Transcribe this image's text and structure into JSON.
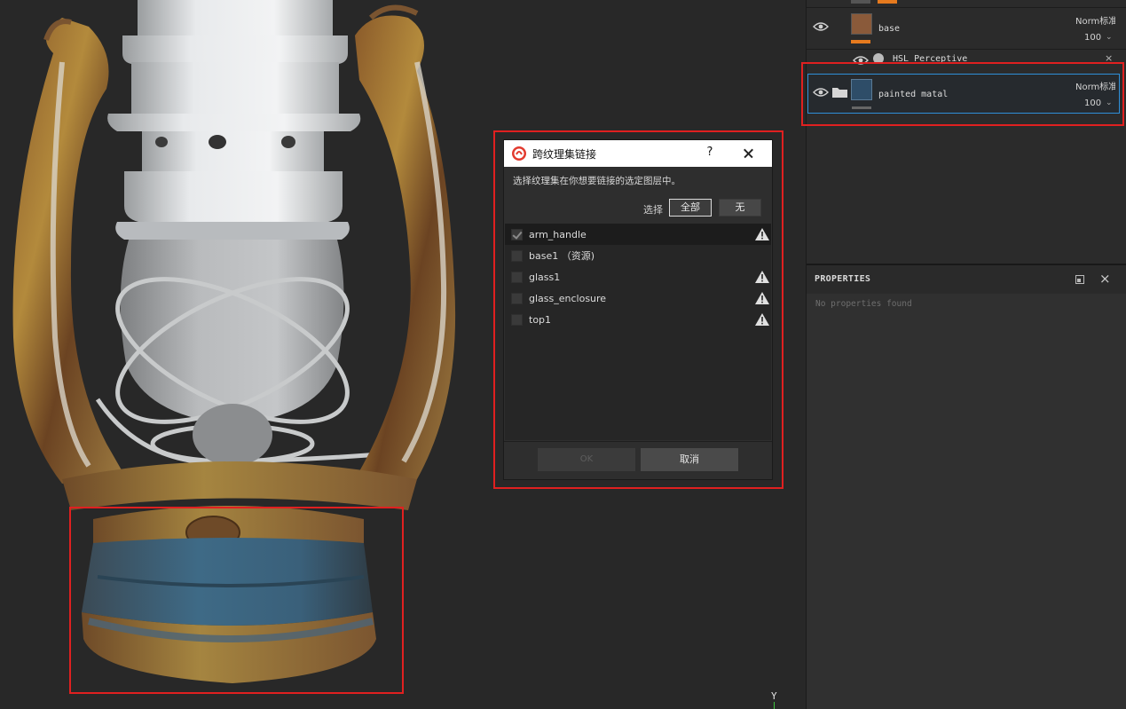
{
  "dialog": {
    "title": "跨纹理集链接",
    "help": "?",
    "description": "选择纹理集在你想要链接的选定图层中。",
    "select_label": "选择",
    "select_all": "全部",
    "select_none": "无",
    "texture_sets": [
      {
        "name": "arm_handle",
        "checked": true,
        "selected": true,
        "warning": true
      },
      {
        "name": "base1 （资源)",
        "checked": false,
        "selected": false,
        "warning": false
      },
      {
        "name": "glass1",
        "checked": false,
        "selected": false,
        "warning": true
      },
      {
        "name": "glass_enclosure",
        "checked": false,
        "selected": false,
        "warning": true
      },
      {
        "name": "top1",
        "checked": false,
        "selected": false,
        "warning": true
      }
    ],
    "ok_label": "OK",
    "cancel_label": "取消"
  },
  "layers": {
    "base": {
      "name": "base",
      "blend": "Norm标准",
      "opacity": "100"
    },
    "hsl_effect": {
      "name": "HSL Perceptive"
    },
    "painted_metal": {
      "name": "painted matal",
      "blend": "Norm标准",
      "opacity": "100"
    }
  },
  "properties": {
    "title": "PROPERTIES",
    "empty_text": "No properties found"
  },
  "viewport": {
    "axis_label": "Y"
  },
  "colors": {
    "highlight_red": "#e02020",
    "selection_blue": "#2f8fd8",
    "layer_accent_orange": "#e67a1e"
  }
}
